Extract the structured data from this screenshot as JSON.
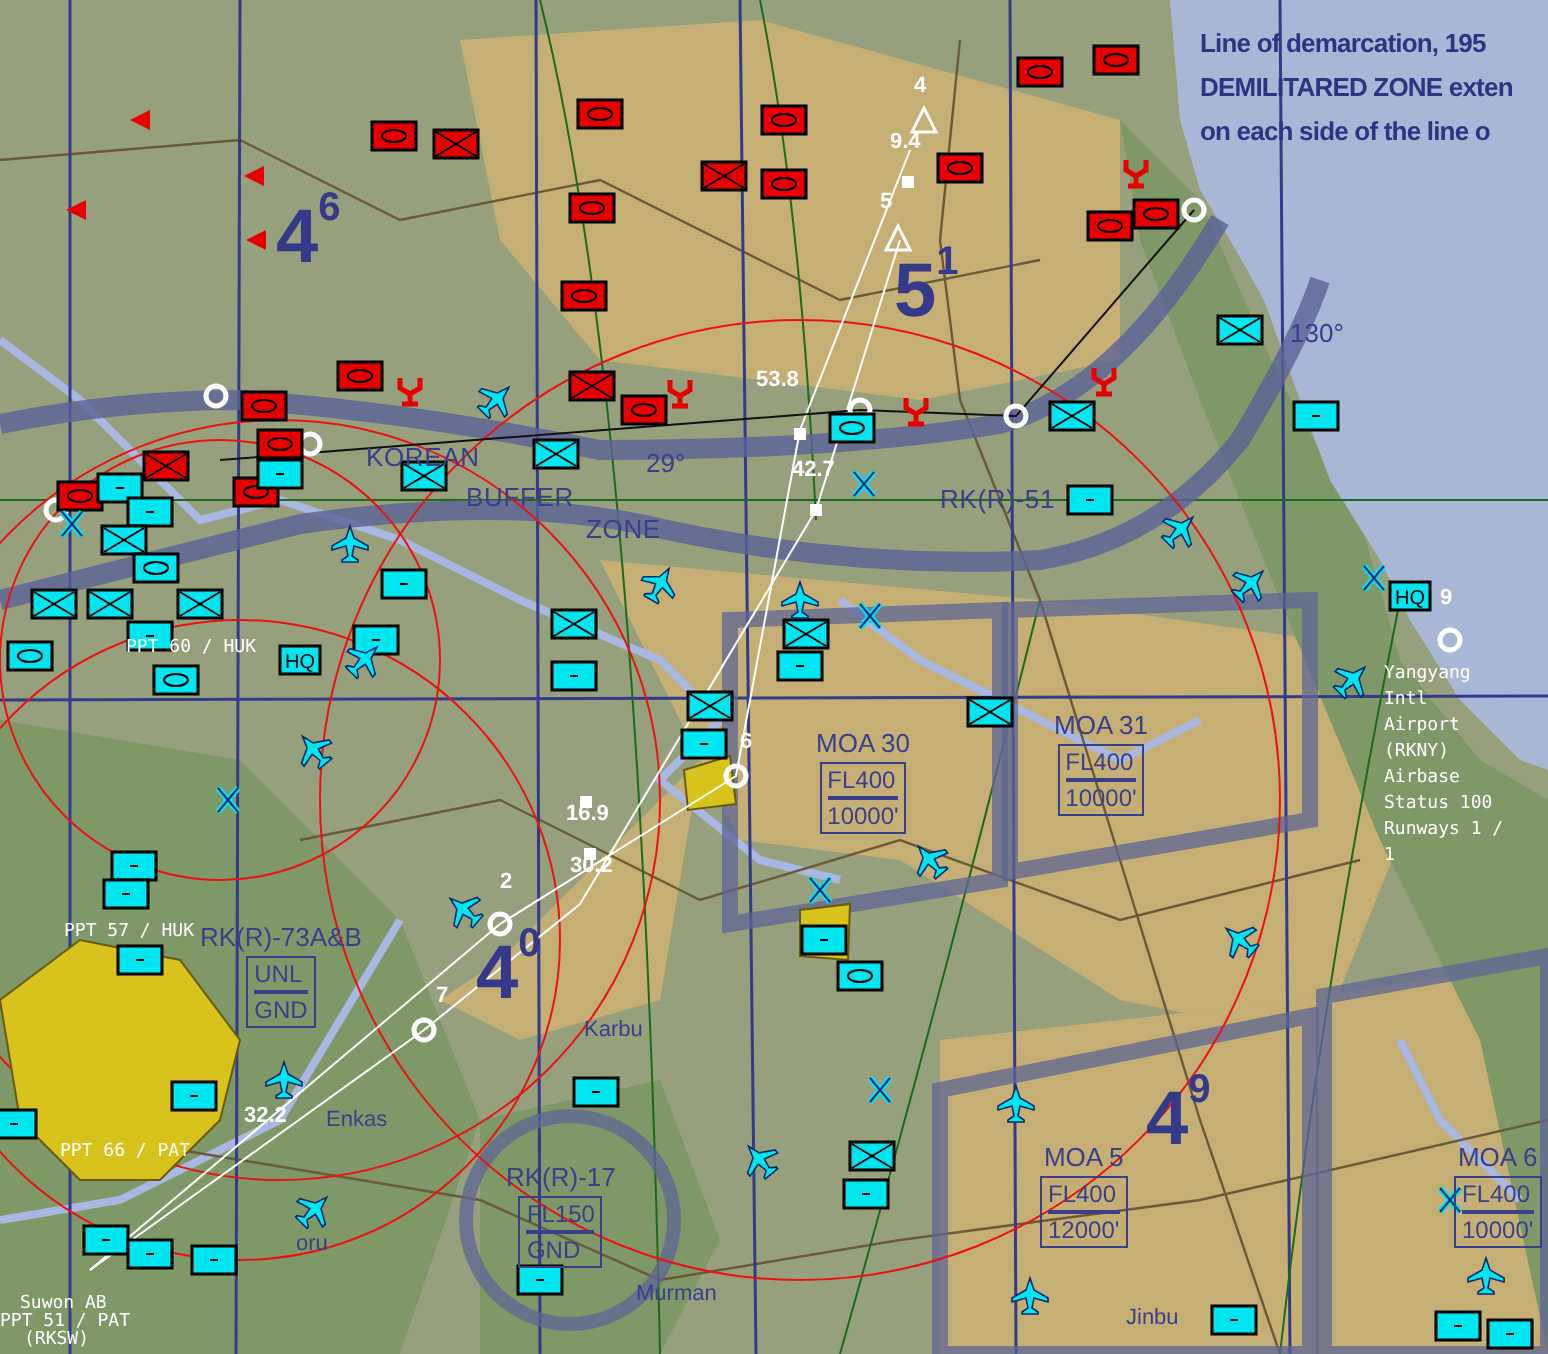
{
  "labels": [
    {
      "text": "Line of demarcation, 195",
      "kind": "banner"
    },
    {
      "text": "DEMILITARED ZONE exten",
      "kind": "banner"
    },
    {
      "text": "on each side of the line o",
      "kind": "banner"
    },
    {
      "text": "4$^{6}$",
      "kind": "sector"
    },
    {
      "text": "5$^{1}$",
      "kind": "sector"
    },
    {
      "text": "4$^{0}$",
      "kind": "sector"
    },
    {
      "text": "4$^{9}$",
      "kind": "sector"
    },
    {
      "text": "KOREAN",
      "kind": "region"
    },
    {
      "text": "BUFFER",
      "kind": "region"
    },
    {
      "text": "ZONE",
      "kind": "region"
    },
    {
      "text": "29°",
      "kind": "bearing"
    },
    {
      "text": "130°",
      "kind": "bearing"
    },
    {
      "text": "RK(R)-51",
      "kind": "region"
    },
    {
      "text": "4",
      "kind": "waypoint"
    },
    {
      "text": "9.4",
      "kind": "waypoint"
    },
    {
      "text": "5",
      "kind": "waypoint"
    },
    {
      "text": "53.8",
      "kind": "waypoint"
    },
    {
      "text": "42.7",
      "kind": "waypoint"
    },
    {
      "text": "6",
      "kind": "waypoint"
    },
    {
      "text": "16.9",
      "kind": "waypoint"
    },
    {
      "text": "30.2",
      "kind": "waypoint"
    },
    {
      "text": "2",
      "kind": "waypoint"
    },
    {
      "text": "7",
      "kind": "waypoint"
    },
    {
      "text": "32.2",
      "kind": "waypoint"
    },
    {
      "text": "9",
      "kind": "waypoint"
    },
    {
      "text": "PPT 60 / HUK",
      "kind": "base"
    },
    {
      "text": "PPT 57 / HUK",
      "kind": "base"
    },
    {
      "text": "PPT 66 / PAT",
      "kind": "base"
    },
    {
      "text": "Suwon AB",
      "kind": "base"
    },
    {
      "text": "PPT 51 / PAT",
      "kind": "base"
    },
    {
      "text": "(RKSW)",
      "kind": "base"
    },
    {
      "text": "Yangyang",
      "kind": "base"
    },
    {
      "text": "Intl",
      "kind": "base"
    },
    {
      "text": "Airport",
      "kind": "base"
    },
    {
      "text": "(RKNY)",
      "kind": "base"
    },
    {
      "text": "Airbase",
      "kind": "base"
    },
    {
      "text": "Status 100",
      "kind": "base"
    },
    {
      "text": "Runways 1 /",
      "kind": "base"
    },
    {
      "text": "1",
      "kind": "base"
    },
    {
      "text": "Karbu",
      "kind": "town"
    },
    {
      "text": "Enkas",
      "kind": "town"
    },
    {
      "text": "oru",
      "kind": "town"
    },
    {
      "text": "Murman",
      "kind": "town"
    },
    {
      "text": "Jinbu",
      "kind": "town"
    }
  ],
  "areas": [
    {
      "name": "MOA 30",
      "ceiling": "FL400",
      "floor": "10000'"
    },
    {
      "name": "MOA 31",
      "ceiling": "FL400",
      "floor": "10000'"
    },
    {
      "name": "MOA 5",
      "ceiling": "FL400",
      "floor": "12000'"
    },
    {
      "name": "MOA 6",
      "ceiling": "FL400",
      "floor": "10000'"
    },
    {
      "name": "RK(R)-17",
      "ceiling": "FL150",
      "floor": "GND"
    },
    {
      "name": "RK(R)-73A&B",
      "ceiling": "UNL",
      "floor": "GND"
    }
  ],
  "units": [
    {
      "color": "#e60000",
      "kind": "armor"
    },
    {
      "color": "#e60000",
      "kind": "infantry"
    },
    {
      "color": "#e60000",
      "kind": "armor"
    },
    {
      "color": "#e60000",
      "kind": "armor"
    },
    {
      "color": "#e60000",
      "kind": "infantry"
    },
    {
      "color": "#e60000",
      "kind": "armor"
    },
    {
      "color": "#e60000",
      "kind": "armor"
    },
    {
      "color": "#e60000",
      "kind": "armor"
    },
    {
      "color": "#e60000",
      "kind": "armor"
    },
    {
      "color": "#e60000",
      "kind": "armor"
    },
    {
      "color": "#e60000",
      "kind": "armor"
    },
    {
      "color": "#e60000",
      "kind": "armor"
    },
    {
      "color": "#e60000",
      "kind": "armor"
    },
    {
      "color": "#e60000",
      "kind": "armor"
    },
    {
      "color": "#e60000",
      "kind": "infantry"
    },
    {
      "color": "#e60000",
      "kind": "armor"
    },
    {
      "color": "#e60000",
      "kind": "armor"
    },
    {
      "color": "#e60000",
      "kind": "armor"
    },
    {
      "color": "#e60000",
      "kind": "infantry"
    },
    {
      "color": "#e60000",
      "kind": "armor"
    },
    {
      "color": "#e60000",
      "kind": "armor"
    },
    {
      "color": "#e60000",
      "kind": "radar"
    },
    {
      "color": "#e60000",
      "kind": "radar"
    },
    {
      "color": "#e60000",
      "kind": "radar"
    },
    {
      "color": "#e60000",
      "kind": "radar"
    },
    {
      "color": "#e60000",
      "kind": "radar"
    },
    {
      "color": "#e60000",
      "kind": "marker"
    },
    {
      "color": "#e60000",
      "kind": "marker"
    },
    {
      "color": "#e60000",
      "kind": "marker"
    },
    {
      "color": "#e60000",
      "kind": "marker"
    },
    {
      "color": "#00e6f0",
      "kind": "support"
    },
    {
      "color": "#00e6f0",
      "kind": "support"
    },
    {
      "color": "#00e6f0",
      "kind": "infantry"
    },
    {
      "color": "#00e6f0",
      "kind": "armor"
    },
    {
      "color": "#00e6f0",
      "kind": "infantry"
    },
    {
      "color": "#00e6f0",
      "kind": "infantry"
    },
    {
      "color": "#00e6f0",
      "kind": "infantry"
    },
    {
      "color": "#00e6f0",
      "kind": "support"
    },
    {
      "color": "#00e6f0",
      "kind": "armor"
    },
    {
      "color": "#00e6f0",
      "kind": "armor"
    },
    {
      "color": "#00e6f0",
      "kind": "infantry"
    },
    {
      "color": "#00e6f0",
      "kind": "infantry"
    },
    {
      "color": "#00e6f0",
      "kind": "support"
    },
    {
      "color": "#00e6f0",
      "kind": "armor"
    },
    {
      "color": "#00e6f0",
      "kind": "infantry"
    },
    {
      "color": "#00e6f0",
      "kind": "support"
    },
    {
      "color": "#00e6f0",
      "kind": "support"
    },
    {
      "color": "#00e6f0",
      "kind": "support"
    },
    {
      "color": "#00e6f0",
      "kind": "infantry"
    },
    {
      "color": "#00e6f0",
      "kind": "support"
    },
    {
      "color": "#00e6f0",
      "kind": "hq",
      "text": "HQ"
    },
    {
      "color": "#00e6f0",
      "kind": "hq",
      "text": "HQ"
    },
    {
      "color": "#00e6f0",
      "kind": "infantry"
    },
    {
      "color": "#00e6f0",
      "kind": "support"
    },
    {
      "color": "#00e6f0",
      "kind": "infantry"
    },
    {
      "color": "#00e6f0",
      "kind": "infantry"
    },
    {
      "color": "#00e6f0",
      "kind": "support"
    },
    {
      "color": "#00e6f0",
      "kind": "support"
    },
    {
      "color": "#00e6f0",
      "kind": "infantry"
    },
    {
      "color": "#00e6f0",
      "kind": "support"
    },
    {
      "color": "#00e6f0",
      "kind": "armor"
    },
    {
      "color": "#00e6f0",
      "kind": "support"
    },
    {
      "color": "#00e6f0",
      "kind": "support"
    },
    {
      "color": "#00e6f0",
      "kind": "infantry"
    },
    {
      "color": "#00e6f0",
      "kind": "support"
    },
    {
      "color": "#00e6f0",
      "kind": "support"
    },
    {
      "color": "#00e6f0",
      "kind": "support"
    },
    {
      "color": "#00e6f0",
      "kind": "support"
    },
    {
      "color": "#00e6f0",
      "kind": "support"
    },
    {
      "color": "#00e6f0",
      "kind": "support"
    },
    {
      "color": "#00e6f0",
      "kind": "support"
    },
    {
      "color": "#00e6f0",
      "kind": "support"
    },
    {
      "color": "#00e6f0",
      "kind": "support"
    },
    {
      "color": "#00e6f0",
      "kind": "support"
    },
    {
      "color": "#00e6f0",
      "kind": "support"
    },
    {
      "color": "#00e6f0",
      "kind": "support"
    },
    {
      "color": "#00e6f0",
      "kind": "plane"
    },
    {
      "color": "#00e6f0",
      "kind": "plane"
    },
    {
      "color": "#00e6f0",
      "kind": "plane"
    },
    {
      "color": "#00e6f0",
      "kind": "plane"
    },
    {
      "color": "#00e6f0",
      "kind": "plane"
    },
    {
      "color": "#00e6f0",
      "kind": "plane"
    },
    {
      "color": "#00e6f0",
      "kind": "plane"
    },
    {
      "color": "#00e6f0",
      "kind": "plane"
    },
    {
      "color": "#00e6f0",
      "kind": "plane"
    },
    {
      "color": "#00e6f0",
      "kind": "plane"
    },
    {
      "color": "#00e6f0",
      "kind": "plane"
    },
    {
      "color": "#00e6f0",
      "kind": "plane"
    },
    {
      "color": "#00e6f0",
      "kind": "plane"
    },
    {
      "color": "#00e6f0",
      "kind": "plane"
    },
    {
      "color": "#00e6f0",
      "kind": "plane"
    },
    {
      "color": "#00e6f0",
      "kind": "plane"
    },
    {
      "color": "#00e6f0",
      "kind": "plane"
    },
    {
      "color": "#00e6f0",
      "kind": "plane"
    },
    {
      "color": "#00e6f0",
      "kind": "airfield"
    },
    {
      "color": "#00e6f0",
      "kind": "airfield"
    },
    {
      "color": "#00e6f0",
      "kind": "airfield"
    },
    {
      "color": "#00e6f0",
      "kind": "airfield"
    },
    {
      "color": "#00e6f0",
      "kind": "airfield"
    },
    {
      "color": "#00e6f0",
      "kind": "airfield"
    },
    {
      "color": "#00e6f0",
      "kind": "airfield"
    },
    {
      "color": "#00e6f0",
      "kind": "airfield"
    }
  ]
}
